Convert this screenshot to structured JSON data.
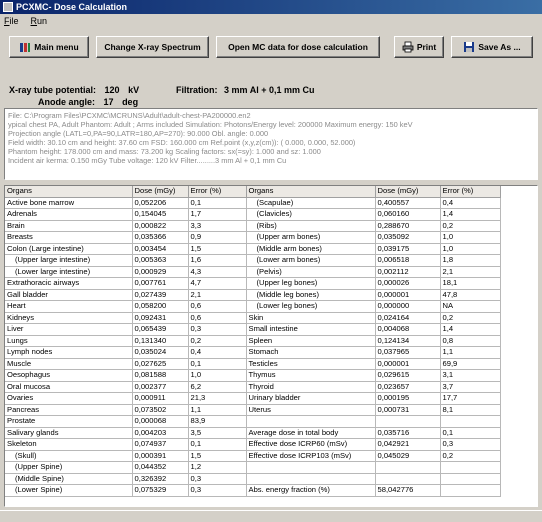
{
  "window": {
    "title": "PCXMC- Dose Calculation"
  },
  "menu": {
    "file": "File",
    "run": "Run",
    "file_u": "F",
    "file_rest": "ile",
    "run_u": "R",
    "run_rest": "un"
  },
  "toolbar": {
    "main_menu": "Main menu",
    "change_spectrum": "Change X-ray Spectrum",
    "open_mc": "Open MC data for dose calculation",
    "print": "Print",
    "save_as": "Save As ..."
  },
  "params": {
    "tube_potential_label": "X-ray tube potential:",
    "tube_potential_value": "120",
    "tube_potential_unit": "kV",
    "anode_angle_label": "Anode angle:",
    "anode_angle_value": "17",
    "anode_angle_unit": "deg",
    "filtration_label": "Filtration:",
    "filtration_value": "3 mm Al + 0,1 mm Cu"
  },
  "file_info": [
    "File: C:\\Program Files\\PCXMC\\MCRUNS\\Adult\\adult-chest-PA200000.en2",
    "ypical chest PA, Adult     Phantom: Adult ; Arms included     Simulation: Photons/Energy level: 200000     Maximum energy: 150 keV",
    "Projection angle (LATL=0,PA=90,LATR=180,AP=270):     90.000     Obl. angle:     0.000",
    "Field width:     30.10 cm     and height:     37.60 cm     FSD:     160.000 cm     Ref.point (x,y,z(cm)):  (  0.000,  0.000,  52.000)",
    "Phantom height:     178.000 cm   and mass:     73.200 kg    Scaling factors: sx(=sy):     1.000     and sz:     1.000",
    "Incident air kerma:         0.150 mGy    Tube voltage:  120 kV      Filter.........3 mm Al + 0,1 mm Cu"
  ],
  "table": {
    "headers": [
      "Organs",
      "Dose (mGy)",
      "Error (%)",
      "Organs",
      "Dose (mGy)",
      "Error (%)"
    ],
    "rows": [
      [
        "Active bone marrow",
        "0,052206",
        "0,1",
        "(Scapulae)",
        "0,400557",
        "0,4"
      ],
      [
        "Adrenals",
        "0,154045",
        "1,7",
        "(Clavicles)",
        "0,060160",
        "1,4"
      ],
      [
        "Brain",
        "0,000822",
        "3,3",
        "(Ribs)",
        "0,288670",
        "0,2"
      ],
      [
        "Breasts",
        "0,035366",
        "0,9",
        "(Upper arm bones)",
        "0,035092",
        "1,0"
      ],
      [
        "Colon (Large intestine)",
        "0,003454",
        "1,5",
        "(Middle arm bones)",
        "0,039175",
        "1,0"
      ],
      [
        "(Upper large intestine)",
        "0,005363",
        "1,6",
        "(Lower arm bones)",
        "0,006518",
        "1,8"
      ],
      [
        "(Lower large intestine)",
        "0,000929",
        "4,3",
        "(Pelvis)",
        "0,002112",
        "2,1"
      ],
      [
        "Extrathoracic airways",
        "0,007761",
        "4,7",
        "(Upper leg bones)",
        "0,000026",
        "18,1"
      ],
      [
        "Gall bladder",
        "0,027439",
        "2,1",
        "(Middle leg bones)",
        "0,000001",
        "47,8"
      ],
      [
        "Heart",
        "0,058200",
        "0,6",
        "(Lower leg bones)",
        "0,000000",
        "NA"
      ],
      [
        "Kidneys",
        "0,092431",
        "0,6",
        "Skin",
        "0,024164",
        "0,2"
      ],
      [
        "Liver",
        "0,065439",
        "0,3",
        "Small intestine",
        "0,004068",
        "1,4"
      ],
      [
        "Lungs",
        "0,131340",
        "0,2",
        "Spleen",
        "0,124134",
        "0,8"
      ],
      [
        "Lymph nodes",
        "0,035024",
        "0,4",
        "Stomach",
        "0,037965",
        "1,1"
      ],
      [
        "Muscle",
        "0,027625",
        "0,1",
        "Testicles",
        "0,000001",
        "69,9"
      ],
      [
        "Oesophagus",
        "0,081588",
        "1,0",
        "Thymus",
        "0,029615",
        "3,1"
      ],
      [
        "Oral mucosa",
        "0,002377",
        "6,2",
        "Thyroid",
        "0,023657",
        "3,7"
      ],
      [
        "Ovaries",
        "0,000911",
        "21,3",
        "Urinary bladder",
        "0,000195",
        "17,7"
      ],
      [
        "Pancreas",
        "0,073502",
        "1,1",
        "Uterus",
        "0,000731",
        "8,1"
      ],
      [
        "Prostate",
        "0,000068",
        "83,9",
        "",
        "",
        ""
      ],
      [
        "Salivary glands",
        "0,004203",
        "3,5",
        "Average dose in total body",
        "0,035716",
        "0,1"
      ],
      [
        "Skeleton",
        "0,074937",
        "0,1",
        "Effective dose ICRP60  (mSv)",
        "0,042921",
        "0,3"
      ],
      [
        "(Skull)",
        "0,000391",
        "1,5",
        "Effective dose ICRP103 (mSv)",
        "0,045029",
        "0,2"
      ],
      [
        "(Upper Spine)",
        "0,044352",
        "1,2",
        "",
        "",
        ""
      ],
      [
        "(Middle Spine)",
        "0,326392",
        "0,3",
        "",
        "",
        ""
      ],
      [
        "(Lower Spine)",
        "0,075329",
        "0,3",
        "Abs. energy fraction (%)",
        "58,042776",
        ""
      ]
    ]
  }
}
